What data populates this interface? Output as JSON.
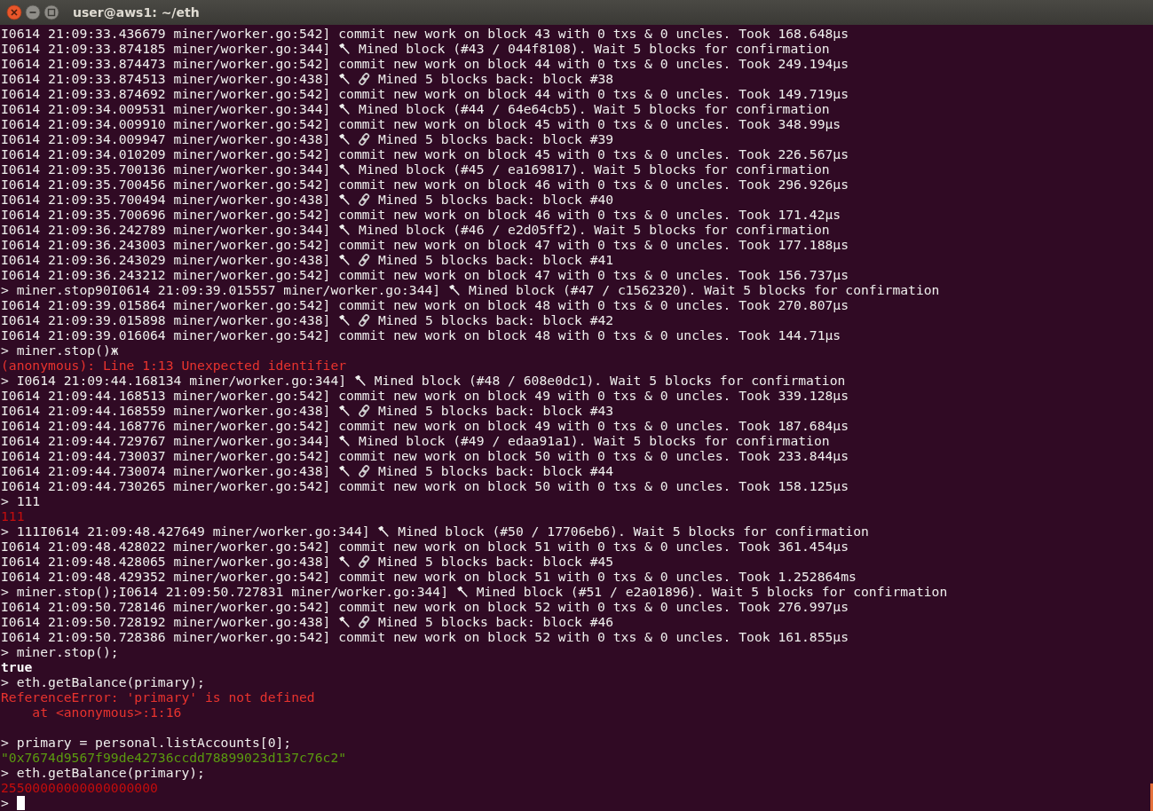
{
  "window": {
    "title": "user@aws1: ~/eth"
  },
  "terminal": {
    "lines": [
      {
        "kind": "out",
        "text": "I0614 21:09:33.436679 miner/worker.go:542] commit new work on block 43 with 0 txs & 0 uncles. Took 168.648µs"
      },
      {
        "kind": "mined",
        "text": "I0614 21:09:33.874185 miner/worker.go:344]",
        "rest": "Mined block (#43 / 044f8108). Wait 5 blocks for confirmation"
      },
      {
        "kind": "out",
        "text": "I0614 21:09:33.874473 miner/worker.go:542] commit new work on block 44 with 0 txs & 0 uncles. Took 249.194µs"
      },
      {
        "kind": "back",
        "text": "I0614 21:09:33.874513 miner/worker.go:438]",
        "rest": "Mined 5 blocks back: block #38"
      },
      {
        "kind": "out",
        "text": "I0614 21:09:33.874692 miner/worker.go:542] commit new work on block 44 with 0 txs & 0 uncles. Took 149.719µs"
      },
      {
        "kind": "mined",
        "text": "I0614 21:09:34.009531 miner/worker.go:344]",
        "rest": "Mined block (#44 / 64e64cb5). Wait 5 blocks for confirmation"
      },
      {
        "kind": "out",
        "text": "I0614 21:09:34.009910 miner/worker.go:542] commit new work on block 45 with 0 txs & 0 uncles. Took 348.99µs"
      },
      {
        "kind": "back",
        "text": "I0614 21:09:34.009947 miner/worker.go:438]",
        "rest": "Mined 5 blocks back: block #39"
      },
      {
        "kind": "out",
        "text": "I0614 21:09:34.010209 miner/worker.go:542] commit new work on block 45 with 0 txs & 0 uncles. Took 226.567µs"
      },
      {
        "kind": "mined",
        "text": "I0614 21:09:35.700136 miner/worker.go:344]",
        "rest": "Mined block (#45 / ea169817). Wait 5 blocks for confirmation"
      },
      {
        "kind": "out",
        "text": "I0614 21:09:35.700456 miner/worker.go:542] commit new work on block 46 with 0 txs & 0 uncles. Took 296.926µs"
      },
      {
        "kind": "back",
        "text": "I0614 21:09:35.700494 miner/worker.go:438]",
        "rest": "Mined 5 blocks back: block #40"
      },
      {
        "kind": "out",
        "text": "I0614 21:09:35.700696 miner/worker.go:542] commit new work on block 46 with 0 txs & 0 uncles. Took 171.42µs"
      },
      {
        "kind": "mined",
        "text": "I0614 21:09:36.242789 miner/worker.go:344]",
        "rest": "Mined block (#46 / e2d05ff2). Wait 5 blocks for confirmation"
      },
      {
        "kind": "out",
        "text": "I0614 21:09:36.243003 miner/worker.go:542] commit new work on block 47 with 0 txs & 0 uncles. Took 177.188µs"
      },
      {
        "kind": "back",
        "text": "I0614 21:09:36.243029 miner/worker.go:438]",
        "rest": "Mined 5 blocks back: block #41"
      },
      {
        "kind": "out",
        "text": "I0614 21:09:36.243212 miner/worker.go:542] commit new work on block 47 with 0 txs & 0 uncles. Took 156.737µs"
      },
      {
        "kind": "mined",
        "text": "> miner.stop90I0614 21:09:39.015557 miner/worker.go:344]",
        "rest": "Mined block (#47 / c1562320). Wait 5 blocks for confirmation"
      },
      {
        "kind": "out",
        "text": "I0614 21:09:39.015864 miner/worker.go:542] commit new work on block 48 with 0 txs & 0 uncles. Took 270.807µs"
      },
      {
        "kind": "back",
        "text": "I0614 21:09:39.015898 miner/worker.go:438]",
        "rest": "Mined 5 blocks back: block #42"
      },
      {
        "kind": "out",
        "text": "I0614 21:09:39.016064 miner/worker.go:542] commit new work on block 48 with 0 txs & 0 uncles. Took 144.71µs"
      },
      {
        "kind": "out",
        "text": "> miner.stop()ж"
      },
      {
        "kind": "error",
        "text": "(anonymous): Line 1:13 Unexpected identifier"
      },
      {
        "kind": "mined",
        "text": "> I0614 21:09:44.168134 miner/worker.go:344]",
        "rest": "Mined block (#48 / 608e0dc1). Wait 5 blocks for confirmation"
      },
      {
        "kind": "out",
        "text": "I0614 21:09:44.168513 miner/worker.go:542] commit new work on block 49 with 0 txs & 0 uncles. Took 339.128µs"
      },
      {
        "kind": "back",
        "text": "I0614 21:09:44.168559 miner/worker.go:438]",
        "rest": "Mined 5 blocks back: block #43"
      },
      {
        "kind": "out",
        "text": "I0614 21:09:44.168776 miner/worker.go:542] commit new work on block 49 with 0 txs & 0 uncles. Took 187.684µs"
      },
      {
        "kind": "mined",
        "text": "I0614 21:09:44.729767 miner/worker.go:344]",
        "rest": "Mined block (#49 / edaa91a1). Wait 5 blocks for confirmation"
      },
      {
        "kind": "out",
        "text": "I0614 21:09:44.730037 miner/worker.go:542] commit new work on block 50 with 0 txs & 0 uncles. Took 233.844µs"
      },
      {
        "kind": "back",
        "text": "I0614 21:09:44.730074 miner/worker.go:438]",
        "rest": "Mined 5 blocks back: block #44"
      },
      {
        "kind": "out",
        "text": "I0614 21:09:44.730265 miner/worker.go:542] commit new work on block 50 with 0 txs & 0 uncles. Took 158.125µs"
      },
      {
        "kind": "out",
        "text": "> 111"
      },
      {
        "kind": "number",
        "text": "111"
      },
      {
        "kind": "mined",
        "text": "> 111I0614 21:09:48.427649 miner/worker.go:344]",
        "rest": "Mined block (#50 / 17706eb6). Wait 5 blocks for confirmation"
      },
      {
        "kind": "out",
        "text": "I0614 21:09:48.428022 miner/worker.go:542] commit new work on block 51 with 0 txs & 0 uncles. Took 361.454µs"
      },
      {
        "kind": "back",
        "text": "I0614 21:09:48.428065 miner/worker.go:438]",
        "rest": "Mined 5 blocks back: block #45"
      },
      {
        "kind": "out",
        "text": "I0614 21:09:48.429352 miner/worker.go:542] commit new work on block 51 with 0 txs & 0 uncles. Took 1.252864ms"
      },
      {
        "kind": "mined",
        "text": "> miner.stop();I0614 21:09:50.727831 miner/worker.go:344]",
        "rest": "Mined block (#51 / e2a01896). Wait 5 blocks for confirmation"
      },
      {
        "kind": "out",
        "text": "I0614 21:09:50.728146 miner/worker.go:542] commit new work on block 52 with 0 txs & 0 uncles. Took 276.997µs"
      },
      {
        "kind": "back",
        "text": "I0614 21:09:50.728192 miner/worker.go:438]",
        "rest": "Mined 5 blocks back: block #46"
      },
      {
        "kind": "out",
        "text": "I0614 21:09:50.728386 miner/worker.go:542] commit new work on block 52 with 0 txs & 0 uncles. Took 161.855µs"
      },
      {
        "kind": "out",
        "text": "> miner.stop();"
      },
      {
        "kind": "bool",
        "text": "true"
      },
      {
        "kind": "out",
        "text": "> eth.getBalance(primary);"
      },
      {
        "kind": "error",
        "text": "ReferenceError: 'primary' is not defined"
      },
      {
        "kind": "error",
        "text": "    at <anonymous>:1:16"
      },
      {
        "kind": "blank"
      },
      {
        "kind": "out",
        "text": "> primary = personal.listAccounts[0];"
      },
      {
        "kind": "string",
        "text": "\"0x7674d9567f99de42736ccdd78899023d137c76c2\""
      },
      {
        "kind": "out",
        "text": "> eth.getBalance(primary);"
      },
      {
        "kind": "number",
        "text": "25500000000000000000"
      },
      {
        "kind": "cursor",
        "text": ">"
      }
    ]
  }
}
